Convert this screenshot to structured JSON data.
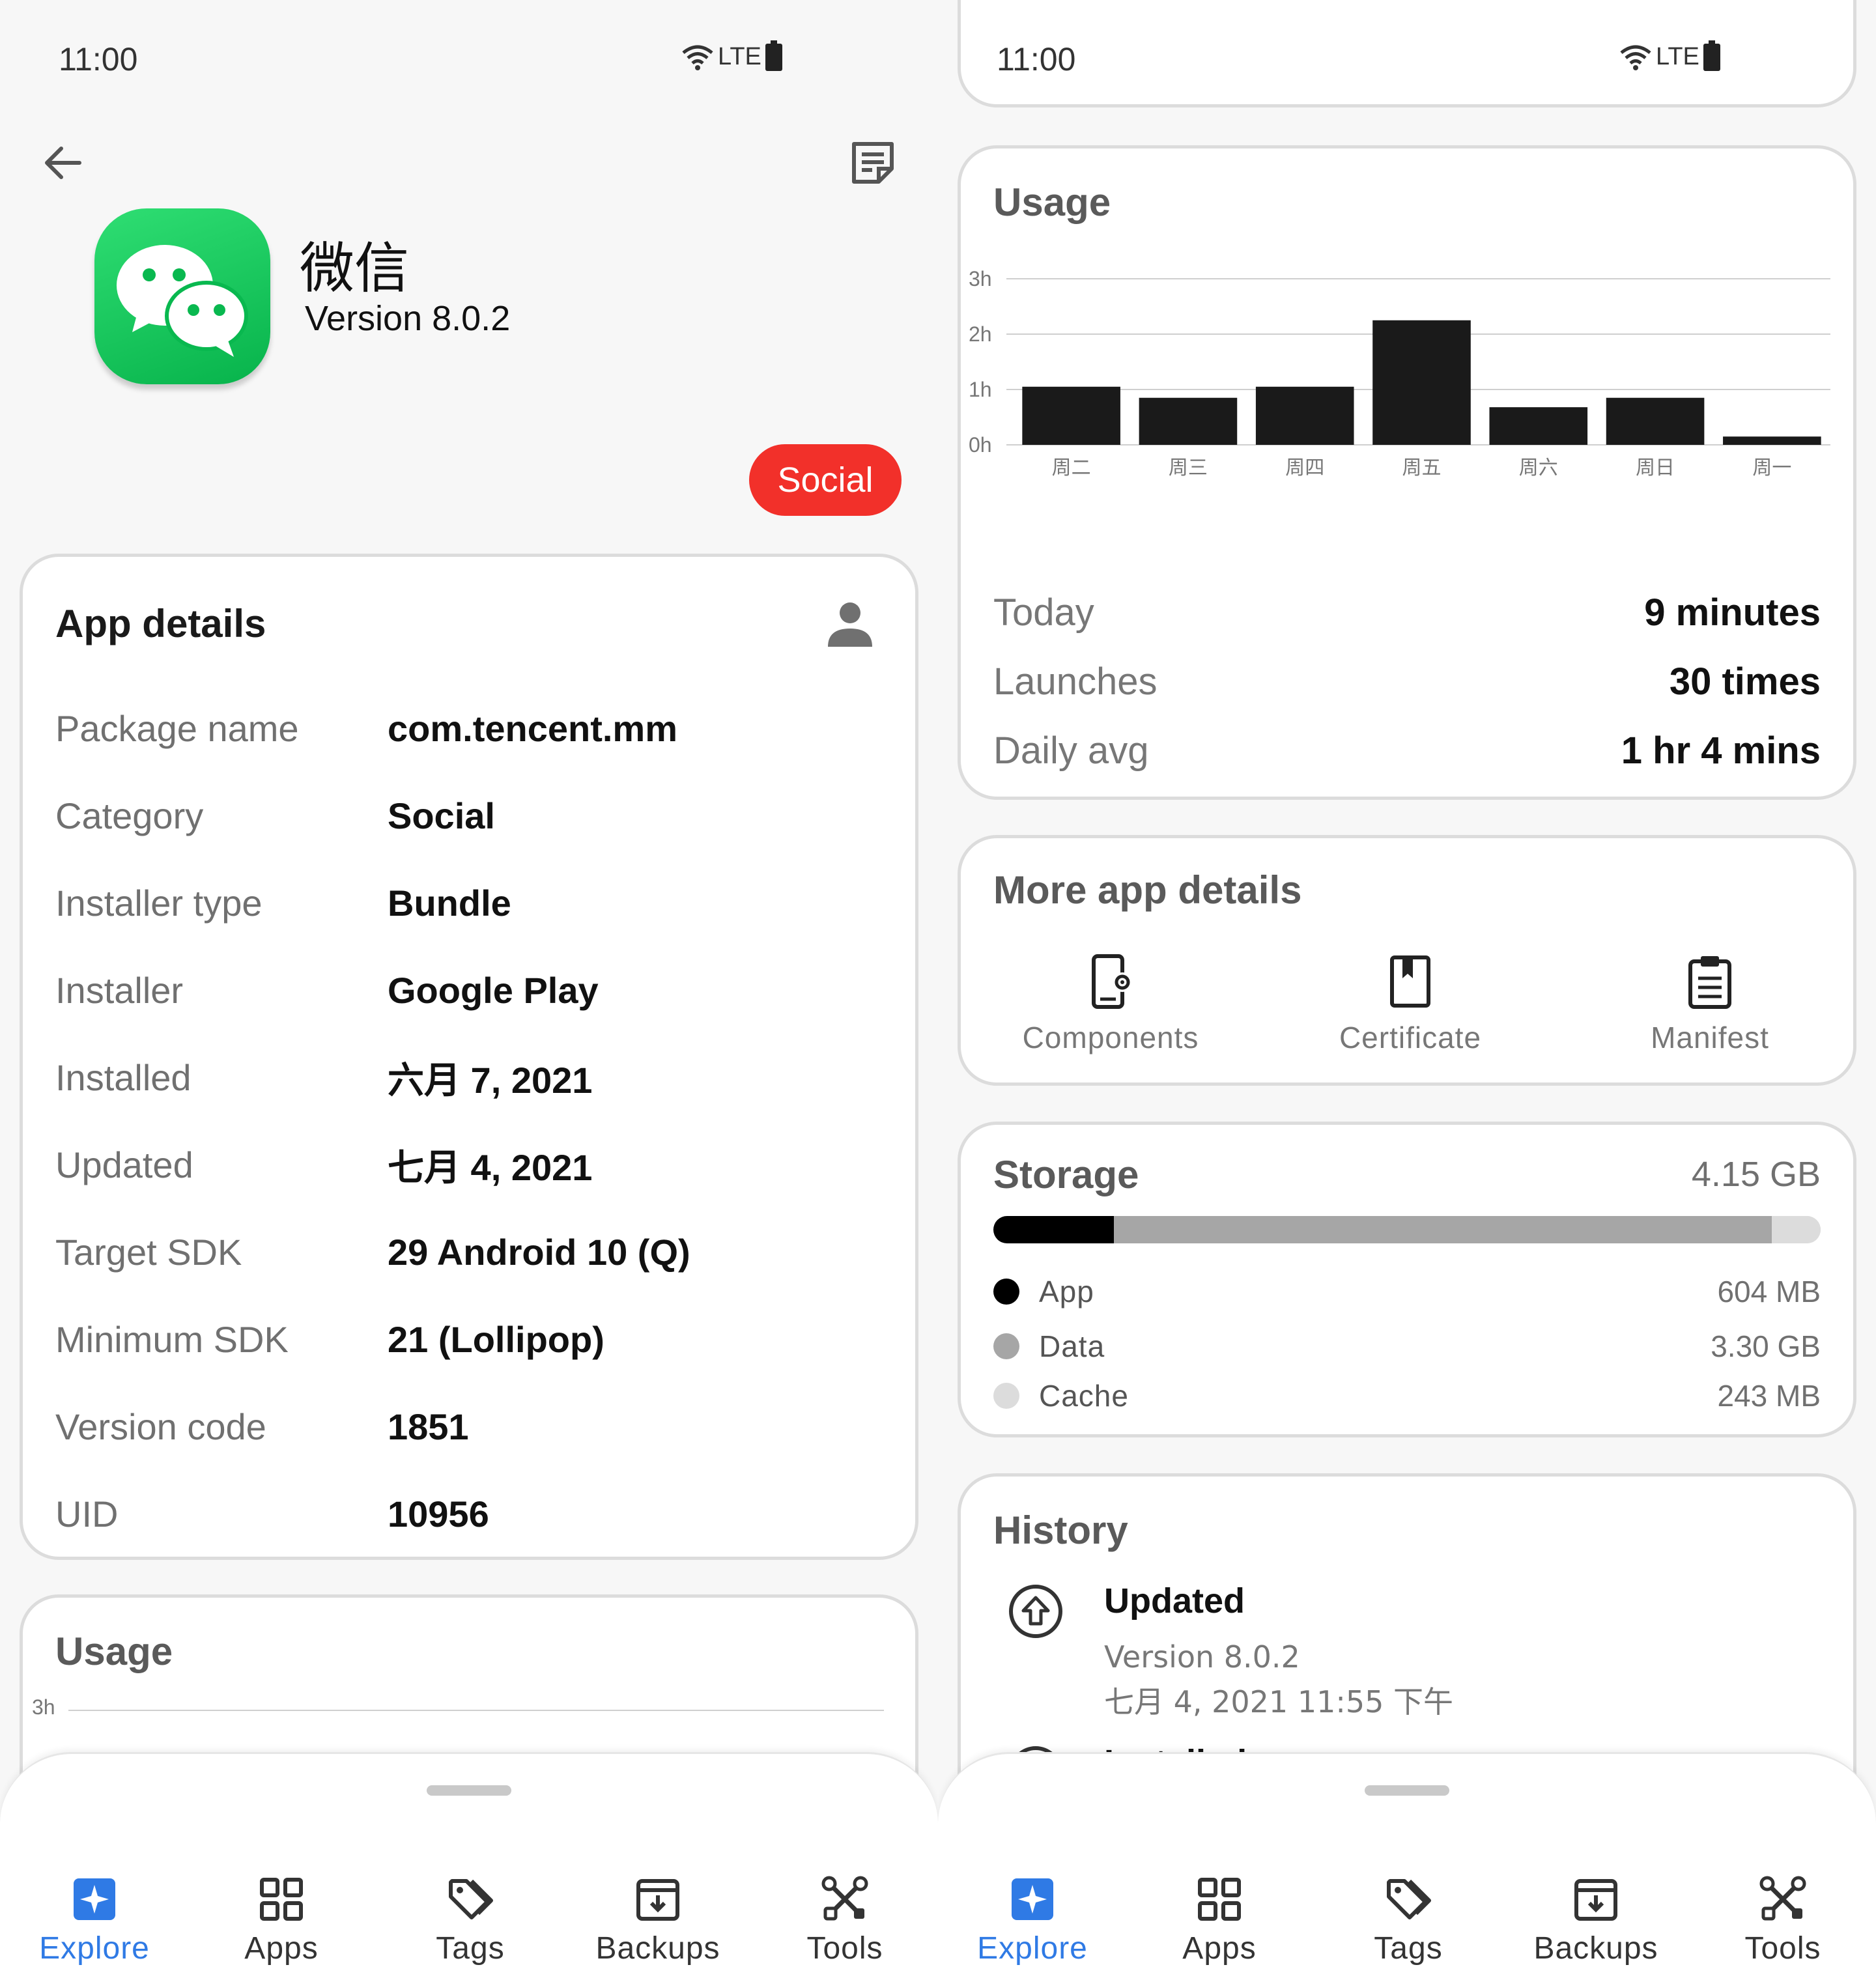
{
  "status_bar": {
    "time": "11:00",
    "network": "LTE"
  },
  "app_header": {
    "name": "微信",
    "version": "Version 8.0.2",
    "category_chip": "Social"
  },
  "app_details": {
    "title": "App details",
    "rows": [
      {
        "label": "Package name",
        "value": "com.tencent.mm"
      },
      {
        "label": "Category",
        "value": "Social"
      },
      {
        "label": "Installer type",
        "value": "Bundle"
      },
      {
        "label": "Installer",
        "value": "Google Play"
      },
      {
        "label": "Installed",
        "value": "六月 7, 2021"
      },
      {
        "label": "Updated",
        "value": "七月 4, 2021"
      },
      {
        "label": "Target SDK",
        "value": "29 Android 10 (Q)"
      },
      {
        "label": "Minimum SDK",
        "value": "21 (Lollipop)"
      },
      {
        "label": "Version code",
        "value": "1851"
      },
      {
        "label": "UID",
        "value": "10956"
      }
    ]
  },
  "usage": {
    "title": "Usage",
    "stats": [
      {
        "label": "Today",
        "value": "9 minutes"
      },
      {
        "label": "Launches",
        "value": "30 times"
      },
      {
        "label": "Daily avg",
        "value": "1 hr 4 mins"
      }
    ]
  },
  "chart_data": {
    "type": "bar",
    "title": "Usage",
    "categories": [
      "周二",
      "周三",
      "周四",
      "周五",
      "周六",
      "周日",
      "周一"
    ],
    "values": [
      1.05,
      0.85,
      1.05,
      2.25,
      0.68,
      0.85,
      0.15
    ],
    "unit": "hours",
    "y_ticks": [
      "0h",
      "1h",
      "2h",
      "3h"
    ],
    "ylim": [
      0,
      3
    ],
    "grid": true,
    "bar_color": "#1a1a1a"
  },
  "more_app_details": {
    "title": "More app details",
    "items": [
      {
        "label": "Components",
        "icon": "phone-gear-icon"
      },
      {
        "label": "Certificate",
        "icon": "certificate-icon"
      },
      {
        "label": "Manifest",
        "icon": "clipboard-icon"
      }
    ]
  },
  "storage": {
    "title": "Storage",
    "total": "4.15 GB",
    "segments": [
      {
        "label": "App",
        "value": "604 MB",
        "fraction": 0.146,
        "color": "#000000"
      },
      {
        "label": "Data",
        "value": "3.30 GB",
        "fraction": 0.795,
        "color": "#a6a6a6"
      },
      {
        "label": "Cache",
        "value": "243 MB",
        "fraction": 0.059,
        "color": "#dcdcdc"
      }
    ]
  },
  "history": {
    "title": "History",
    "entries": [
      {
        "title": "Updated",
        "version": "Version 8.0.2",
        "date": "七月 4, 2021 11:55 下午"
      }
    ],
    "cut_off_title": "Installed"
  },
  "bottom_nav": {
    "items": [
      {
        "label": "Explore",
        "active": true
      },
      {
        "label": "Apps",
        "active": false
      },
      {
        "label": "Tags",
        "active": false
      },
      {
        "label": "Backups",
        "active": false
      },
      {
        "label": "Tools",
        "active": false
      }
    ],
    "active_color": "#2f7ae5"
  },
  "colors": {
    "accent": "#2f7ae5",
    "chip": "#f2302a",
    "brand": "#07c160"
  }
}
